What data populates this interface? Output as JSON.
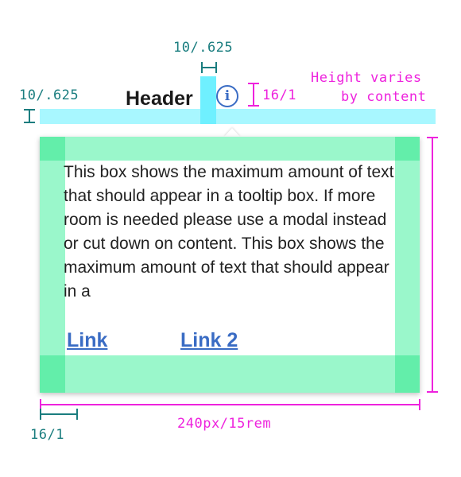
{
  "header": {
    "title": "Header",
    "info_icon_glyph": "i"
  },
  "tooltip": {
    "body": "This box shows the maximum amount of text that should appear in a tooltip box. If more room is needed please use a modal instead or cut down on content. This box shows the maximum amount of text that should appear in a",
    "links": [
      "Link",
      "Link 2"
    ]
  },
  "annotations": {
    "top_spacing_label": "10/.625",
    "left_spacing_label": "10/.625",
    "icon_size_label": "16/1",
    "height_note_line1": "Height varies",
    "height_note_line2": "by content",
    "width_label": "240px/15rem",
    "padding_label": "16/1"
  },
  "colors": {
    "spacing_cyan": "#a8f7ff",
    "padding_green": "#9af7cb",
    "annotation_teal": "#1a7d7f",
    "annotation_magenta": "#ee22dd",
    "link_blue": "#3a6cc4"
  }
}
